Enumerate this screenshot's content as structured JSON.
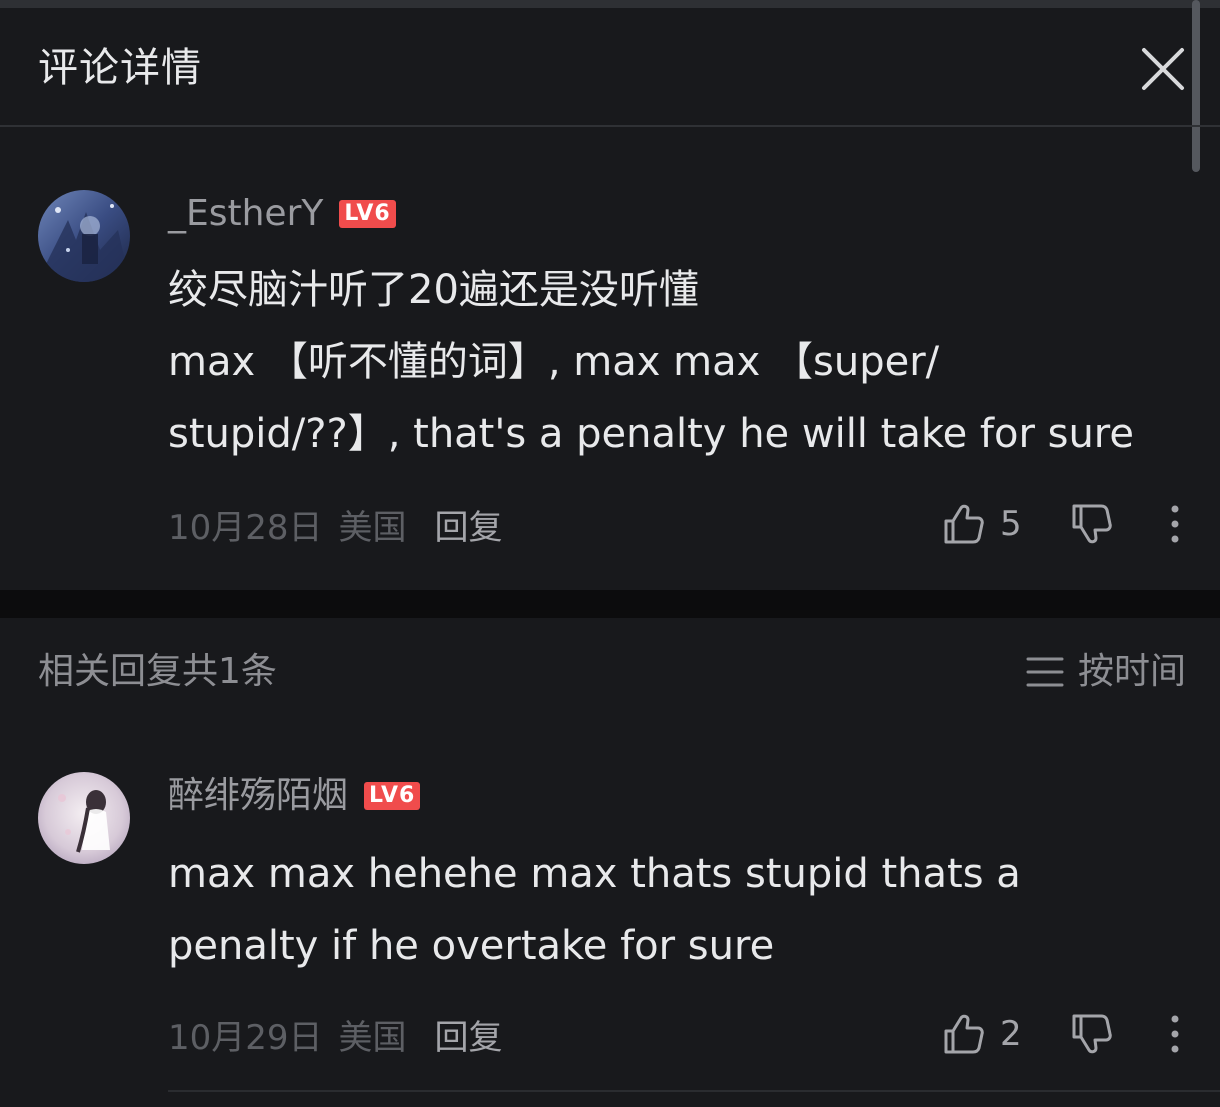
{
  "header": {
    "title": "评论详情",
    "close_icon": "close-icon"
  },
  "main_comment": {
    "username": "_EstherY",
    "level": "LV6",
    "lines": [
      "绞尽脑汁听了20遍还是没听懂",
      "max 【听不懂的词】, max max 【super/",
      "stupid/??】, that's a penalty he will take for sure"
    ],
    "date": "10月28日",
    "location": "美国",
    "reply_label": "回复",
    "likes": "5"
  },
  "replies_section": {
    "count_label": "相关回复共1条",
    "sort_label": "按时间",
    "sort_icon": "menu-lines-icon"
  },
  "reply_comment": {
    "username": "醉绯殇陌烟",
    "level": "LV6",
    "lines": [
      "max max hehehe max thats stupid thats a",
      "penalty if he overtake for sure"
    ],
    "date": "10月29日",
    "location": "美国",
    "reply_label": "回复",
    "likes": "2"
  },
  "colors": {
    "background": "#18191c",
    "level_badge": "#f04c4c",
    "text_primary": "#e8e9eb",
    "text_secondary": "#9a9ba0"
  }
}
